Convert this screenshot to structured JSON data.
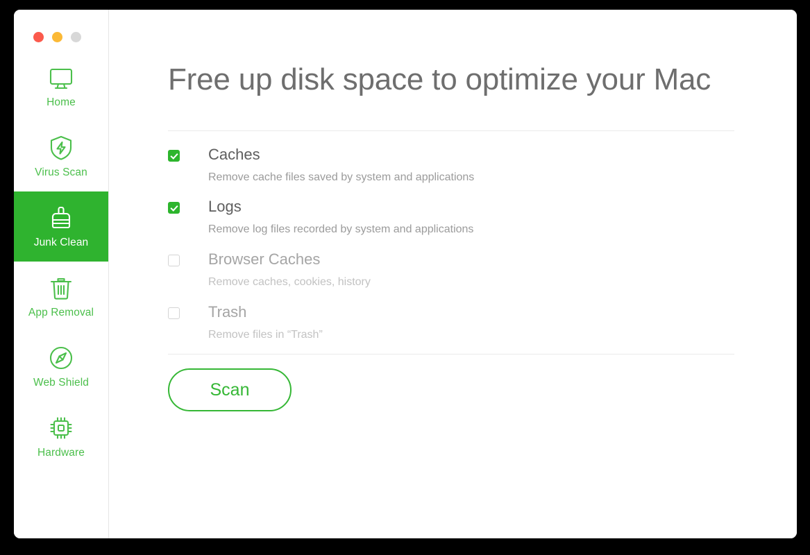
{
  "window": {
    "traffic_lights": [
      {
        "name": "close",
        "color": "#fb5a4c"
      },
      {
        "name": "minimize",
        "color": "#fbb936"
      },
      {
        "name": "maximize",
        "color": "#d8d8d8"
      }
    ]
  },
  "theme": {
    "accent_green": "#2fb32f",
    "icon_green": "#4bbf4b",
    "checkbox_green": "#2db52d",
    "button_green": "#35b735",
    "title_gray": "#6e6e6e",
    "desc_gray": "#9b9b9b",
    "disabled_gray": "#a5a5a5",
    "divider_gray": "#eaeaea"
  },
  "sidebar": {
    "items": [
      {
        "label": "Home",
        "icon": "monitor-icon",
        "active": false
      },
      {
        "label": "Virus Scan",
        "icon": "shield-bolt-icon",
        "active": false
      },
      {
        "label": "Junk Clean",
        "icon": "brush-icon",
        "active": true
      },
      {
        "label": "App Removal",
        "icon": "trash-icon",
        "active": false
      },
      {
        "label": "Web Shield",
        "icon": "compass-icon",
        "active": false
      },
      {
        "label": "Hardware",
        "icon": "chip-icon",
        "active": false
      }
    ]
  },
  "main": {
    "title": "Free up disk space to optimize your Mac",
    "options": [
      {
        "label": "Caches",
        "description": "Remove cache files saved by system and applications",
        "checked": true
      },
      {
        "label": "Logs",
        "description": "Remove log files recorded by system and applications",
        "checked": true
      },
      {
        "label": "Browser Caches",
        "description": "Remove caches, cookies, history",
        "checked": false
      },
      {
        "label": "Trash",
        "description": "Remove files in “Trash”",
        "checked": false
      }
    ],
    "scan_button_label": "Scan"
  }
}
